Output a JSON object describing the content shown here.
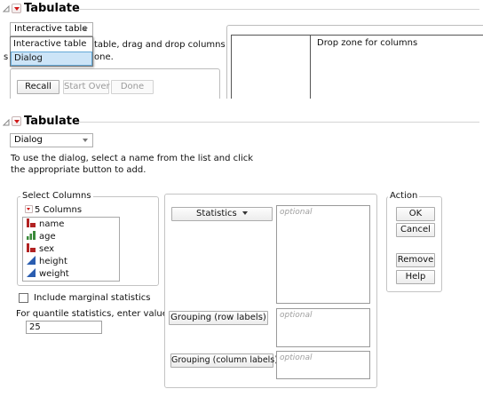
{
  "top_window": {
    "title": "Tabulate",
    "mode_combo_value": "Interactive table",
    "dropdown_options": [
      "Interactive table",
      "Dialog"
    ],
    "selected_option": "Dialog",
    "instruction_partial_line1": "table, drag and drop columns or",
    "instruction_partial_line2": "one.",
    "instruction_edge_char": "s",
    "buttons": {
      "recall": "Recall",
      "start_over": "Start Over",
      "done": "Done"
    },
    "drop_zone_label": "Drop zone for columns"
  },
  "bottom_window": {
    "title": "Tabulate",
    "mode_combo_value": "Dialog",
    "instruction_line1": "To use the dialog, select a name from the list and click",
    "instruction_line2": "the appropriate button to add.",
    "select_columns": {
      "legend": "Select Columns",
      "count_label": "5 Columns",
      "columns": [
        {
          "name": "name",
          "icon": "nominal-icon",
          "color": "#b22222"
        },
        {
          "name": "age",
          "icon": "ordinal-icon",
          "color": "#3a8a3a"
        },
        {
          "name": "sex",
          "icon": "nominal-icon",
          "color": "#b22222"
        },
        {
          "name": "height",
          "icon": "continuous-icon",
          "color": "#2a5db0"
        },
        {
          "name": "weight",
          "icon": "continuous-icon",
          "color": "#2a5db0"
        }
      ]
    },
    "include_marginal_label": "Include marginal statistics",
    "quantile_label": "For quantile statistics, enter value (%)",
    "quantile_value": "25",
    "roles": {
      "statistics": "Statistics",
      "grouping_rows": "Grouping (row labels)",
      "grouping_columns": "Grouping (column labels)",
      "placeholder": "optional"
    },
    "action": {
      "legend": "Action",
      "ok": "OK",
      "cancel": "Cancel",
      "remove": "Remove",
      "help": "Help"
    }
  }
}
